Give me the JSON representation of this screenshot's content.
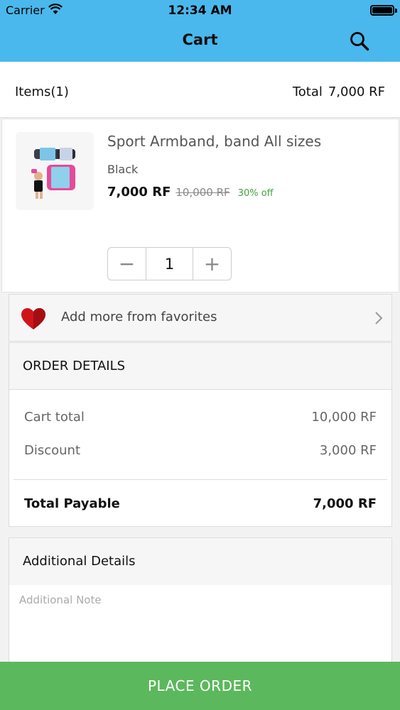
{
  "status_bar": {
    "carrier": "Carrier",
    "time": "12:34 AM"
  },
  "header": {
    "title": "Cart"
  },
  "summary": {
    "items_label": "Items(1)",
    "total_label": "Total",
    "total_value": "7,000 RF"
  },
  "product": {
    "name": "Sport Armband, band All sizes",
    "variant": "Black",
    "price": "7,000 RF",
    "old_price": "10,000 RF",
    "discount": "30% off",
    "quantity": "1",
    "minus": "−",
    "plus": "+"
  },
  "favorites": {
    "label": "Add more from favorites"
  },
  "order_details": {
    "title": "ORDER DETAILS",
    "cart_total_label": "Cart total",
    "cart_total_value": "10,000 RF",
    "discount_label": "Discount",
    "discount_value": "3,000 RF",
    "total_payable_label": "Total Payable",
    "total_payable_value": "7,000 RF"
  },
  "additional": {
    "title": "Additional Details",
    "note_placeholder": "Additional Note"
  },
  "footer": {
    "place_order_label": "PLACE ORDER"
  },
  "colors": {
    "header": "#4ab8ec",
    "place_order": "#5cb85c",
    "discount": "#3fa33f",
    "heart": "#d0141c"
  },
  "icons": [
    "wifi-icon",
    "battery-icon",
    "search-icon",
    "heart-icon",
    "chevron-right-icon"
  ]
}
